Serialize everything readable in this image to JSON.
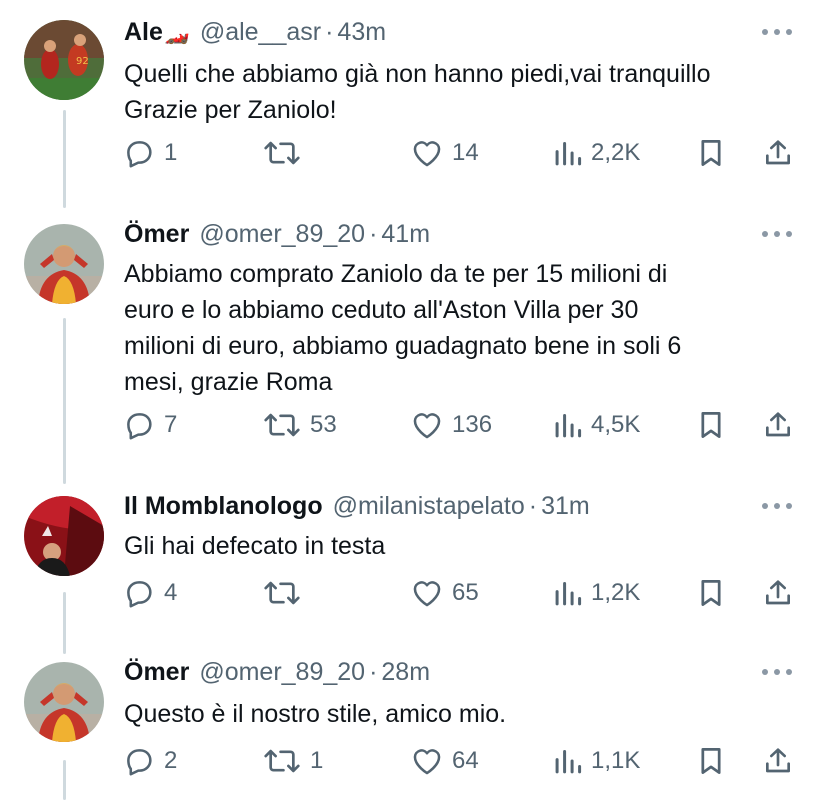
{
  "tweets": [
    {
      "name": "Ale",
      "emoji": "🏎️",
      "handle": "@ale__asr",
      "time": "43m",
      "text": "Quelli che abbiamo già non hanno piedi,vai tranquillo\nGrazie per Zaniolo!",
      "replies": "1",
      "retweets": "",
      "likes": "14",
      "views": "2,2K",
      "avatar_colors": [
        "#7a2b1f",
        "#c8a25a",
        "#2f5e2e"
      ]
    },
    {
      "name": "Ömer",
      "emoji": "",
      "handle": "@omer_89_20",
      "time": "41m",
      "text": "Abbiamo comprato Zaniolo da te per 15 milioni di\neuro e lo abbiamo ceduto all'Aston Villa per 30\nmilioni di euro, abbiamo guadagnato bene in soli 6\nmesi, grazie Roma",
      "replies": "7",
      "retweets": "53",
      "likes": "136",
      "views": "4,5K",
      "avatar_colors": [
        "#a7b3a8",
        "#c8362b",
        "#f2b330"
      ]
    },
    {
      "name": "Il Momblanologo",
      "emoji": "",
      "handle": "@milanistapelato",
      "time": "31m",
      "text": "Gli hai defecato in testa",
      "replies": "4",
      "retweets": "",
      "likes": "65",
      "views": "1,2K",
      "avatar_colors": [
        "#7d1014",
        "#c2202a",
        "#1b1b1b"
      ]
    },
    {
      "name": "Ömer",
      "emoji": "",
      "handle": "@omer_89_20",
      "time": "28m",
      "text": "Questo è il nostro stile, amico mio.",
      "replies": "2",
      "retweets": "1",
      "likes": "64",
      "views": "1,1K",
      "avatar_colors": [
        "#a7b3a8",
        "#c8362b",
        "#f2b330"
      ]
    }
  ],
  "icons": {
    "reply": "reply-icon",
    "retweet": "retweet-icon",
    "like": "heart-icon",
    "views": "views-icon",
    "bookmark": "bookmark-icon",
    "share": "share-icon",
    "more": "more-icon"
  },
  "colors": {
    "text": "#0f1419",
    "secondary": "#536471",
    "thread_line": "#cfd9de"
  }
}
